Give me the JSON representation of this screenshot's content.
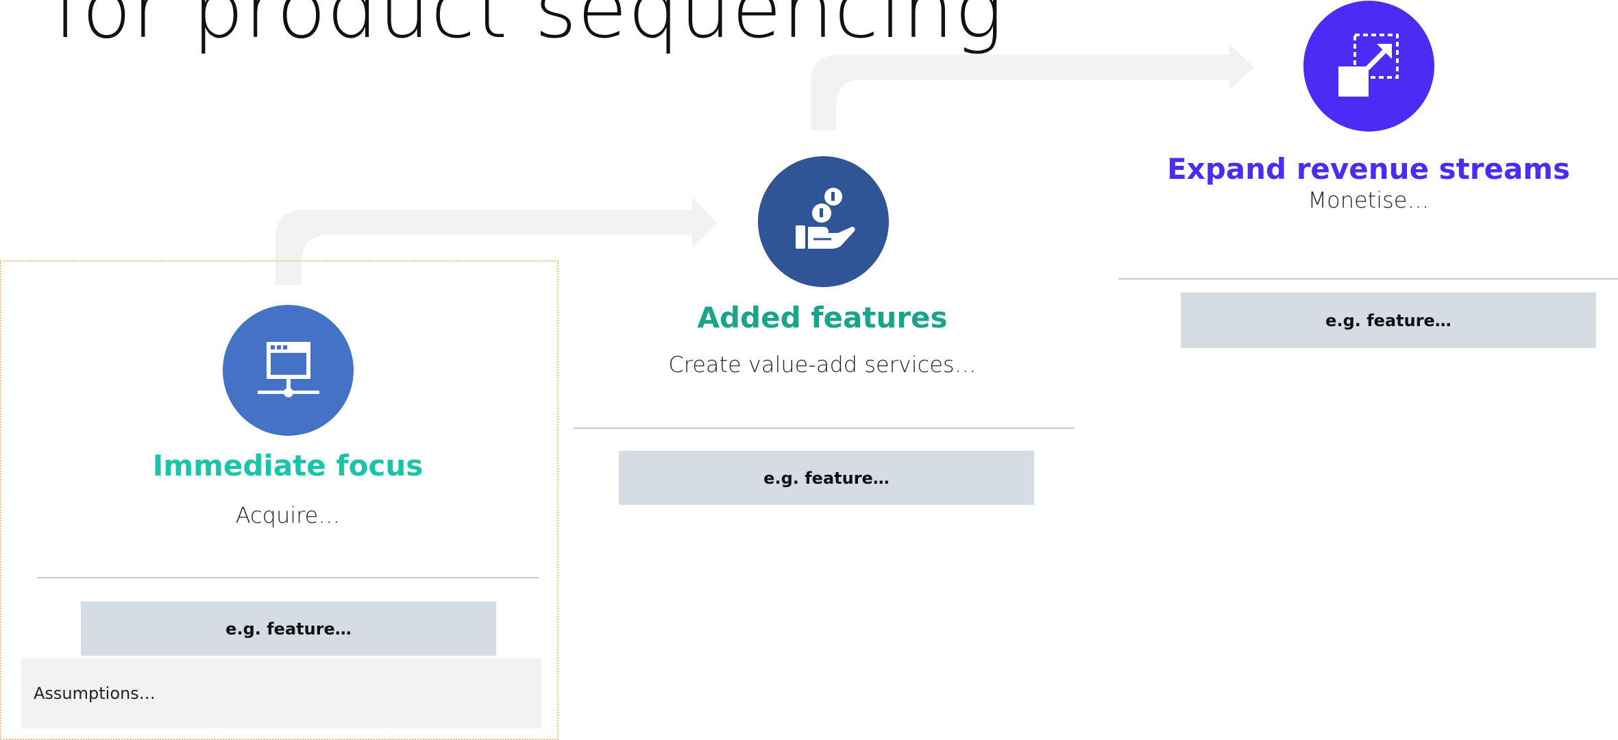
{
  "title": "for product sequencing",
  "colors": {
    "stage1_circle": "#4472c4",
    "stage1_heading": "#19c5a8",
    "stage2_circle": "#2f5597",
    "stage2_heading": "#1aa58a",
    "stage3_circle": "#4a2cf5",
    "stage3_heading": "#4a2cf5",
    "feature_bg": "#d6dce4",
    "connector": "#f2f2f2",
    "dotted_border": "#f2c46a"
  },
  "stages": [
    {
      "icon": "network-server-icon",
      "heading": "Immediate focus",
      "description": "Acquire…",
      "feature": "e.g. feature…",
      "assumptions": "Assumptions…"
    },
    {
      "icon": "hand-coins-icon",
      "heading": "Added features",
      "description": "Create value-add services…",
      "feature": "e.g. feature…"
    },
    {
      "icon": "expand-arrow-icon",
      "heading": "Expand revenue streams",
      "description": "Monetise…",
      "feature": "e.g. feature…"
    }
  ]
}
